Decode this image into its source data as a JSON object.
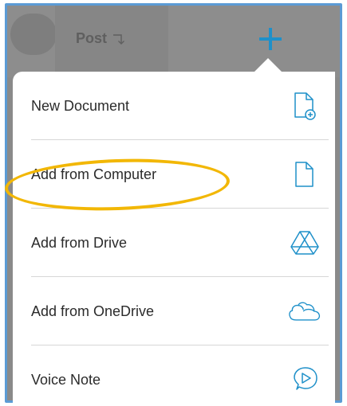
{
  "toolbar": {
    "post_label": "Post",
    "add_icon": "plus-icon",
    "post_icon": "arrow-turn-down-icon"
  },
  "menu": {
    "items": [
      {
        "label": "New Document",
        "icon": "new-document-icon"
      },
      {
        "label": "Add from Computer",
        "icon": "document-icon"
      },
      {
        "label": "Add from Drive",
        "icon": "google-drive-icon"
      },
      {
        "label": "Add from OneDrive",
        "icon": "cloud-icon"
      },
      {
        "label": "Voice Note",
        "icon": "voice-note-icon"
      }
    ]
  },
  "colors": {
    "accent": "#1f90c9",
    "highlight": "#f2b705",
    "frame": "#5b9bd5",
    "dim": "#8d8d8d"
  }
}
